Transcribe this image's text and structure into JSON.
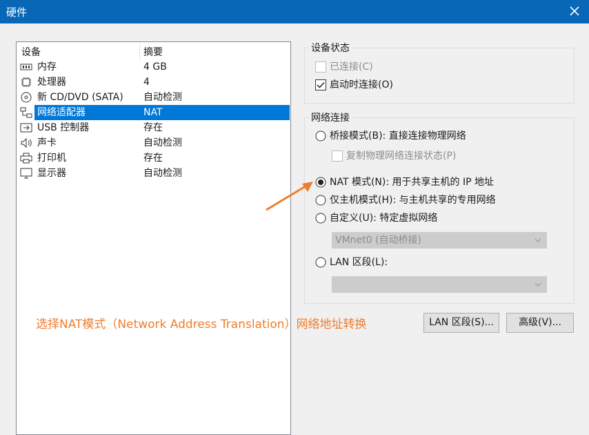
{
  "window": {
    "title": "硬件"
  },
  "device_list": {
    "col_device": "设备",
    "col_summary": "摘要",
    "items": [
      {
        "name": "内存",
        "summary": "4 GB",
        "icon": "memory-icon"
      },
      {
        "name": "处理器",
        "summary": "4",
        "icon": "processor-icon"
      },
      {
        "name": "新 CD/DVD (SATA)",
        "summary": "自动检测",
        "icon": "cd-dvd-icon"
      },
      {
        "name": "网络适配器",
        "summary": "NAT",
        "icon": "network-adapter-icon",
        "selected": true
      },
      {
        "name": "USB 控制器",
        "summary": "存在",
        "icon": "usb-icon"
      },
      {
        "name": "声卡",
        "summary": "自动检测",
        "icon": "speaker-icon"
      },
      {
        "name": "打印机",
        "summary": "存在",
        "icon": "printer-icon"
      },
      {
        "name": "显示器",
        "summary": "自动检测",
        "icon": "monitor-icon"
      }
    ]
  },
  "device_status": {
    "title": "设备状态",
    "connected": {
      "label": "已连接(C)",
      "checked": false,
      "enabled": false
    },
    "connect_at_power_on": {
      "label": "启动时连接(O)",
      "checked": true,
      "enabled": true
    }
  },
  "network_connection": {
    "title": "网络连接",
    "bridged": "桥接模式(B): 直接连接物理网络",
    "replicate": "复制物理网络连接状态(P)",
    "nat": "NAT 模式(N): 用于共享主机的 IP 地址",
    "host_only": "仅主机模式(H): 与主机共享的专用网络",
    "custom": "自定义(U): 特定虚拟网络",
    "custom_value": "VMnet0 (自动桥接)",
    "lan_segment": "LAN 区段(L):",
    "lan_value": "",
    "selected": "nat"
  },
  "buttons": {
    "lan_segments": "LAN 区段(S)...",
    "advanced": "高级(V)..."
  },
  "annotation": "选择NAT模式（Network Address Translation）网络地址转换",
  "colors": {
    "titlebar": "#0867b7",
    "selection": "#0078d7",
    "annotation": "#ef7d2d"
  }
}
